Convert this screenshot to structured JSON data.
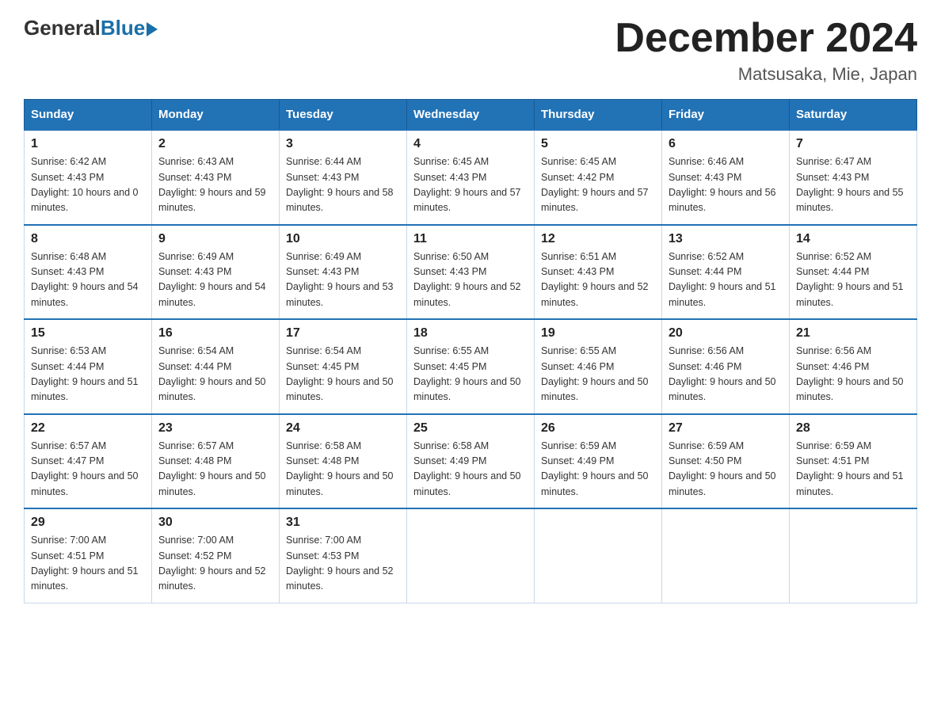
{
  "logo": {
    "general": "General",
    "blue": "Blue"
  },
  "title": "December 2024",
  "location": "Matsusaka, Mie, Japan",
  "days_of_week": [
    "Sunday",
    "Monday",
    "Tuesday",
    "Wednesday",
    "Thursday",
    "Friday",
    "Saturday"
  ],
  "weeks": [
    [
      {
        "day": "1",
        "sunrise": "6:42 AM",
        "sunset": "4:43 PM",
        "daylight": "10 hours and 0 minutes."
      },
      {
        "day": "2",
        "sunrise": "6:43 AM",
        "sunset": "4:43 PM",
        "daylight": "9 hours and 59 minutes."
      },
      {
        "day": "3",
        "sunrise": "6:44 AM",
        "sunset": "4:43 PM",
        "daylight": "9 hours and 58 minutes."
      },
      {
        "day": "4",
        "sunrise": "6:45 AM",
        "sunset": "4:43 PM",
        "daylight": "9 hours and 57 minutes."
      },
      {
        "day": "5",
        "sunrise": "6:45 AM",
        "sunset": "4:42 PM",
        "daylight": "9 hours and 57 minutes."
      },
      {
        "day": "6",
        "sunrise": "6:46 AM",
        "sunset": "4:43 PM",
        "daylight": "9 hours and 56 minutes."
      },
      {
        "day": "7",
        "sunrise": "6:47 AM",
        "sunset": "4:43 PM",
        "daylight": "9 hours and 55 minutes."
      }
    ],
    [
      {
        "day": "8",
        "sunrise": "6:48 AM",
        "sunset": "4:43 PM",
        "daylight": "9 hours and 54 minutes."
      },
      {
        "day": "9",
        "sunrise": "6:49 AM",
        "sunset": "4:43 PM",
        "daylight": "9 hours and 54 minutes."
      },
      {
        "day": "10",
        "sunrise": "6:49 AM",
        "sunset": "4:43 PM",
        "daylight": "9 hours and 53 minutes."
      },
      {
        "day": "11",
        "sunrise": "6:50 AM",
        "sunset": "4:43 PM",
        "daylight": "9 hours and 52 minutes."
      },
      {
        "day": "12",
        "sunrise": "6:51 AM",
        "sunset": "4:43 PM",
        "daylight": "9 hours and 52 minutes."
      },
      {
        "day": "13",
        "sunrise": "6:52 AM",
        "sunset": "4:44 PM",
        "daylight": "9 hours and 51 minutes."
      },
      {
        "day": "14",
        "sunrise": "6:52 AM",
        "sunset": "4:44 PM",
        "daylight": "9 hours and 51 minutes."
      }
    ],
    [
      {
        "day": "15",
        "sunrise": "6:53 AM",
        "sunset": "4:44 PM",
        "daylight": "9 hours and 51 minutes."
      },
      {
        "day": "16",
        "sunrise": "6:54 AM",
        "sunset": "4:44 PM",
        "daylight": "9 hours and 50 minutes."
      },
      {
        "day": "17",
        "sunrise": "6:54 AM",
        "sunset": "4:45 PM",
        "daylight": "9 hours and 50 minutes."
      },
      {
        "day": "18",
        "sunrise": "6:55 AM",
        "sunset": "4:45 PM",
        "daylight": "9 hours and 50 minutes."
      },
      {
        "day": "19",
        "sunrise": "6:55 AM",
        "sunset": "4:46 PM",
        "daylight": "9 hours and 50 minutes."
      },
      {
        "day": "20",
        "sunrise": "6:56 AM",
        "sunset": "4:46 PM",
        "daylight": "9 hours and 50 minutes."
      },
      {
        "day": "21",
        "sunrise": "6:56 AM",
        "sunset": "4:46 PM",
        "daylight": "9 hours and 50 minutes."
      }
    ],
    [
      {
        "day": "22",
        "sunrise": "6:57 AM",
        "sunset": "4:47 PM",
        "daylight": "9 hours and 50 minutes."
      },
      {
        "day": "23",
        "sunrise": "6:57 AM",
        "sunset": "4:48 PM",
        "daylight": "9 hours and 50 minutes."
      },
      {
        "day": "24",
        "sunrise": "6:58 AM",
        "sunset": "4:48 PM",
        "daylight": "9 hours and 50 minutes."
      },
      {
        "day": "25",
        "sunrise": "6:58 AM",
        "sunset": "4:49 PM",
        "daylight": "9 hours and 50 minutes."
      },
      {
        "day": "26",
        "sunrise": "6:59 AM",
        "sunset": "4:49 PM",
        "daylight": "9 hours and 50 minutes."
      },
      {
        "day": "27",
        "sunrise": "6:59 AM",
        "sunset": "4:50 PM",
        "daylight": "9 hours and 50 minutes."
      },
      {
        "day": "28",
        "sunrise": "6:59 AM",
        "sunset": "4:51 PM",
        "daylight": "9 hours and 51 minutes."
      }
    ],
    [
      {
        "day": "29",
        "sunrise": "7:00 AM",
        "sunset": "4:51 PM",
        "daylight": "9 hours and 51 minutes."
      },
      {
        "day": "30",
        "sunrise": "7:00 AM",
        "sunset": "4:52 PM",
        "daylight": "9 hours and 52 minutes."
      },
      {
        "day": "31",
        "sunrise": "7:00 AM",
        "sunset": "4:53 PM",
        "daylight": "9 hours and 52 minutes."
      },
      null,
      null,
      null,
      null
    ]
  ]
}
